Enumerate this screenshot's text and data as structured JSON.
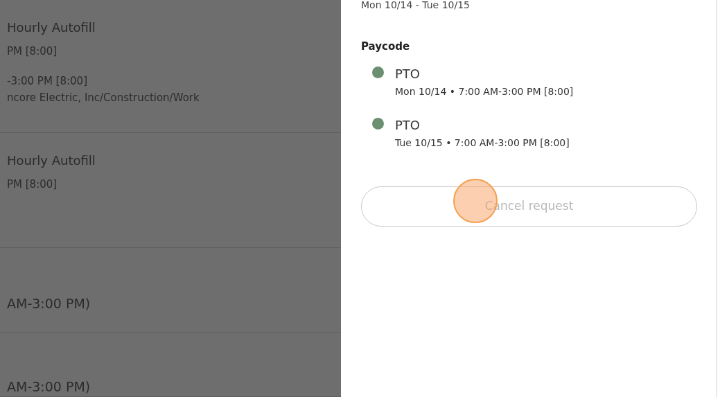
{
  "background_list": [
    {
      "title": "Hourly Autofill",
      "lines": [
        "PM [8:00]",
        "-3:00 PM [8:00]",
        "ncore Electric, Inc/Construction/Work"
      ]
    },
    {
      "title": "Hourly Autofill",
      "lines": [
        "PM [8:00]"
      ]
    },
    {
      "lines": [
        "AM-3:00 PM)"
      ]
    },
    {
      "lines": [
        "AM-3:00 PM)"
      ]
    }
  ],
  "panel": {
    "date_range": "Mon 10/14 - Tue 10/15",
    "section_title": "Paycode",
    "paycodes": [
      {
        "name": "PTO",
        "detail": "Mon 10/14 • 7:00 AM-3:00 PM [8:00]",
        "color": "#6a8f71"
      },
      {
        "name": "PTO",
        "detail": "Tue 10/15 • 7:00 AM-3:00 PM [8:00]",
        "color": "#6a8f71"
      }
    ],
    "button": {
      "label": "Cancel request",
      "disabled": true
    }
  }
}
